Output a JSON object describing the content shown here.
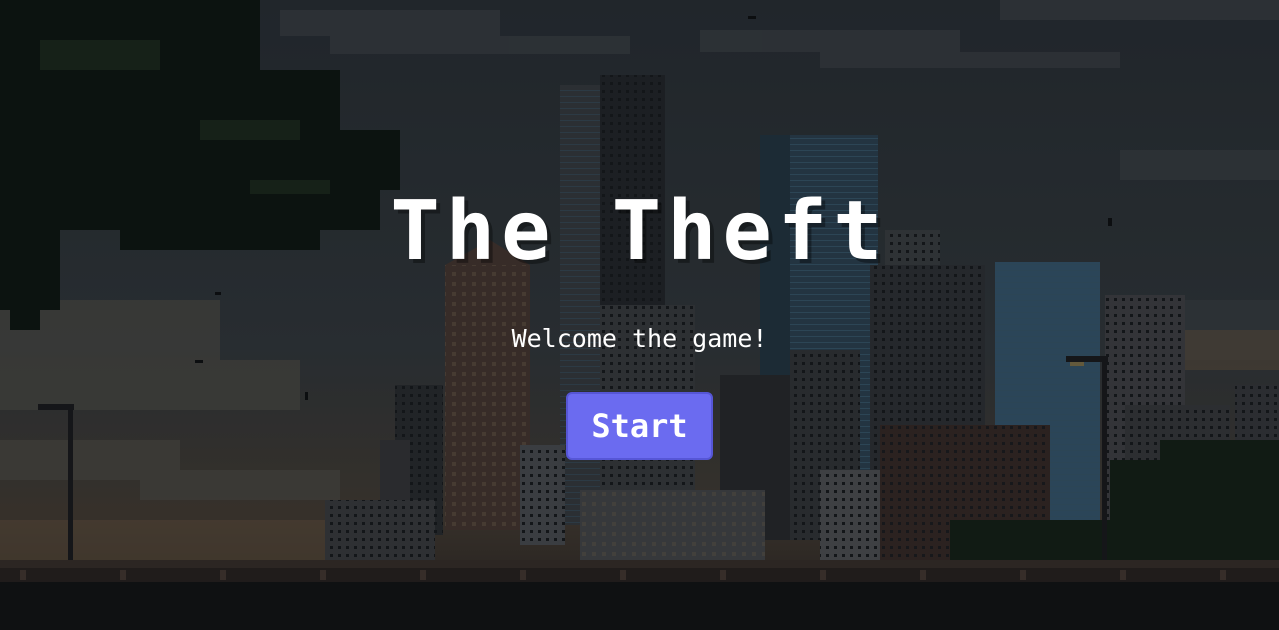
{
  "game": {
    "title": "The Theft",
    "subtitle": "Welcome the game!",
    "start_label": "Start"
  },
  "colors": {
    "button_background": "#6b6bf0",
    "title_text": "#ffffff",
    "sky_dark": "#2a3138",
    "foliage": "#0f1a12"
  }
}
